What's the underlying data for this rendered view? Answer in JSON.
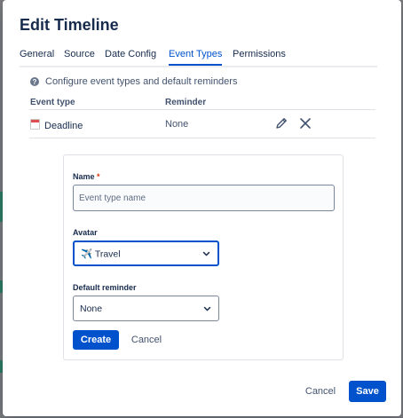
{
  "dialog": {
    "title": "Edit Timeline",
    "tabs": [
      {
        "label": "General",
        "active": false
      },
      {
        "label": "Source",
        "active": false
      },
      {
        "label": "Date Config",
        "active": false
      },
      {
        "label": "Event Types",
        "active": true
      },
      {
        "label": "Permissions",
        "active": false
      }
    ],
    "hint": "Configure event types and default reminders",
    "hint_icon": "question-circle-icon",
    "table": {
      "columns": [
        "Event type",
        "Reminder"
      ],
      "rows": [
        {
          "icon": "calendar-icon",
          "name": "Deadline",
          "reminder": "None"
        }
      ]
    },
    "form": {
      "name_label": "Name",
      "required_marker": "*",
      "name_placeholder": "Event type name",
      "name_value": "",
      "avatar_label": "Avatar",
      "avatar_value": "Travel",
      "avatar_emoji": "✈️",
      "reminder_label": "Default reminder",
      "reminder_value": "None",
      "create_label": "Create",
      "cancel_label": "Cancel"
    },
    "footer": {
      "cancel_label": "Cancel",
      "save_label": "Save"
    }
  },
  "colors": {
    "primary": "#0052cc",
    "text": "#172b4d",
    "subtle_text": "#42526e",
    "required": "#de350b"
  }
}
